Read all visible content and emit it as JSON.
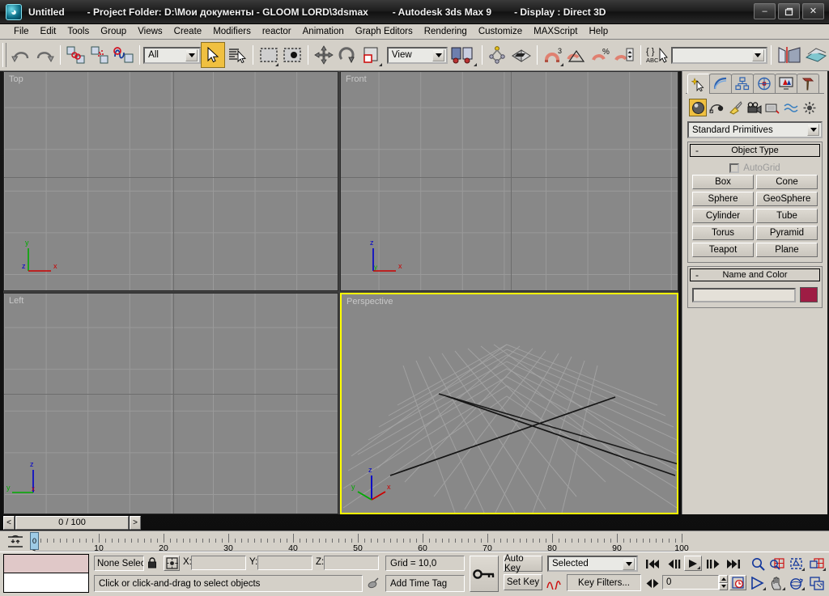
{
  "window": {
    "app_icon": "3dsmax-logo-icon",
    "title_name": "Untitled",
    "title_project": "- Project Folder: D:\\Мои документы - GLOOM LORD\\3dsmax",
    "title_app": "- Autodesk 3ds Max 9",
    "title_display": "- Display : Direct 3D",
    "minimize_label": "–",
    "maximize_label": "❐",
    "close_label": "✕"
  },
  "menubar": {
    "items": [
      "File",
      "Edit",
      "Tools",
      "Group",
      "Views",
      "Create",
      "Modifiers",
      "reactor",
      "Animation",
      "Graph Editors",
      "Rendering",
      "Customize",
      "MAXScript",
      "Help"
    ]
  },
  "toolbar": {
    "undo": "undo-icon",
    "redo": "redo-icon",
    "select_link": "select-and-link-icon",
    "unlink": "unlink-selection-icon",
    "bind_space_warp": "bind-to-space-warp-icon",
    "selection_filter_value": "All",
    "select_object": "select-object-icon",
    "select_by_name": "select-by-name-icon",
    "select_region_rect": "rectangular-selection-region-icon",
    "window_crossing": "window-crossing-icon",
    "select_move": "select-and-move-icon",
    "select_rotate": "select-and-rotate-icon",
    "select_scale": "select-and-uniform-scale-icon",
    "reference_coord_value": "View",
    "pivot_center": "use-pivot-point-center-icon",
    "select_region_pivot": "use-selection-center-icon",
    "mirror": "mirror-icon",
    "align": "align-icon",
    "snap3d": "snaps-toggle-3-icon",
    "angle_snap": "angle-snap-toggle-icon",
    "percent_snap": "percent-snap-toggle-icon",
    "spinner_snap": "spinner-snap-toggle-icon",
    "named_selection": "named-selection-sets-icon",
    "named_selection_value": "",
    "mirror_named": "mirror-named-icon",
    "layer_manager": "layer-manager-icon"
  },
  "viewports": [
    {
      "name": "Top",
      "tripod": "top",
      "axes": {
        "up": "y",
        "right": "x",
        "origin": "z"
      }
    },
    {
      "name": "Front",
      "tripod": "front",
      "axes": {
        "up": "z",
        "right": "x",
        "origin": "y"
      }
    },
    {
      "name": "Left",
      "tripod": "left",
      "axes": {
        "up": "z",
        "left": "y",
        "origin": "x"
      }
    },
    {
      "name": "Perspective",
      "tripod": "persp",
      "axes": {
        "up": "z",
        "right": "x",
        "left": "y"
      }
    }
  ],
  "command_panel": {
    "tabs": [
      {
        "name": "create-tab",
        "icon": "star-arrow-icon",
        "selected": true
      },
      {
        "name": "modify-tab",
        "icon": "curve-icon",
        "selected": false
      },
      {
        "name": "hierarchy-tab",
        "icon": "hierarchy-icon",
        "selected": false
      },
      {
        "name": "motion-tab",
        "icon": "wheel-icon",
        "selected": false
      },
      {
        "name": "display-tab",
        "icon": "monitor-icon",
        "selected": false
      },
      {
        "name": "utilities-tab",
        "icon": "hammer-icon",
        "selected": false
      }
    ],
    "categories": [
      {
        "name": "geometry",
        "icon": "sphere-icon",
        "selected": true
      },
      {
        "name": "shapes",
        "icon": "shapes-icon",
        "selected": false
      },
      {
        "name": "lights",
        "icon": "light-icon",
        "selected": false
      },
      {
        "name": "cameras",
        "icon": "camera-icon",
        "selected": false
      },
      {
        "name": "helpers",
        "icon": "helper-icon",
        "selected": false
      },
      {
        "name": "space-warps",
        "icon": "wave-icon",
        "selected": false
      },
      {
        "name": "systems",
        "icon": "systems-icon",
        "selected": false
      }
    ],
    "subcategory_value": "Standard Primitives",
    "object_type": {
      "title": "Object Type",
      "collapse": "-",
      "autogrid_label": "AutoGrid",
      "autogrid_checked": false,
      "buttons": [
        "Box",
        "Cone",
        "Sphere",
        "GeoSphere",
        "Cylinder",
        "Tube",
        "Torus",
        "Pyramid",
        "Teapot",
        "Plane"
      ]
    },
    "name_and_color": {
      "title": "Name and Color",
      "collapse": "-",
      "name_value": "",
      "color_hex": "#9e1d44"
    }
  },
  "timeslider": {
    "prev_label": "<",
    "next_label": ">",
    "frame_label": "0 / 100"
  },
  "trackbar": {
    "open_mini_curve_editor": "open-mini-curve-editor-icon",
    "ruler_min": 0,
    "ruler_max": 100,
    "ruler_labels": [
      0,
      10,
      20,
      30,
      40,
      50,
      60,
      70,
      80,
      90,
      100
    ],
    "slider_position": 0
  },
  "statusbar": {
    "selection_text": "None Selected",
    "lock_icon": "lock-selection-icon",
    "abs_rel_icon": "absolute-relative-transform-icon",
    "coord_x_label": "X:",
    "coord_x_value": "",
    "coord_y_label": "Y:",
    "coord_y_value": "",
    "coord_z_label": "Z:",
    "coord_z_value": "",
    "grid_text": "Grid = 10,0",
    "add_time_tag": "Add Time Tag",
    "prompt_text": "Click or click-and-drag to select objects",
    "comm_center_icon": "communication-center-icon",
    "key_mode_icon": "key-mode-toggle-icon",
    "auto_key": "Auto Key",
    "set_key": "Set Key",
    "key_filter_curve_icon": "set-key-filters-curve-icon",
    "key_filters": "Key Filters...",
    "selection_set_value": "Selected",
    "playback": {
      "goto_start": "go-to-start-icon",
      "prev_frame": "previous-frame-icon",
      "play": "play-animation-icon",
      "next_frame": "next-frame-icon",
      "goto_end": "go-to-end-icon",
      "key_mode": "key-mode-toggle-icon",
      "current_frame_value": "0",
      "time_config": "time-configuration-icon"
    },
    "view_tools": {
      "zoom": "zoom-icon",
      "zoom_all": "zoom-all-icon",
      "zoom_extents": "zoom-extents-icon",
      "zoom_extents_all": "zoom-extents-all-icon",
      "field_of_view": "field-of-view-icon",
      "pan": "pan-view-icon",
      "arc_rotate": "arc-rotate-icon",
      "maximize_viewport": "maximize-viewport-toggle-icon"
    }
  },
  "colors": {
    "panel": "#d4d0c8",
    "viewport_bg": "#888888",
    "viewport_grid": "#9a9a9a",
    "active_viewport_border": "#ffff00",
    "highlight": "#f0c040",
    "axis_x": "#cc0000",
    "axis_y": "#00aa00",
    "axis_z": "#0000cc"
  }
}
